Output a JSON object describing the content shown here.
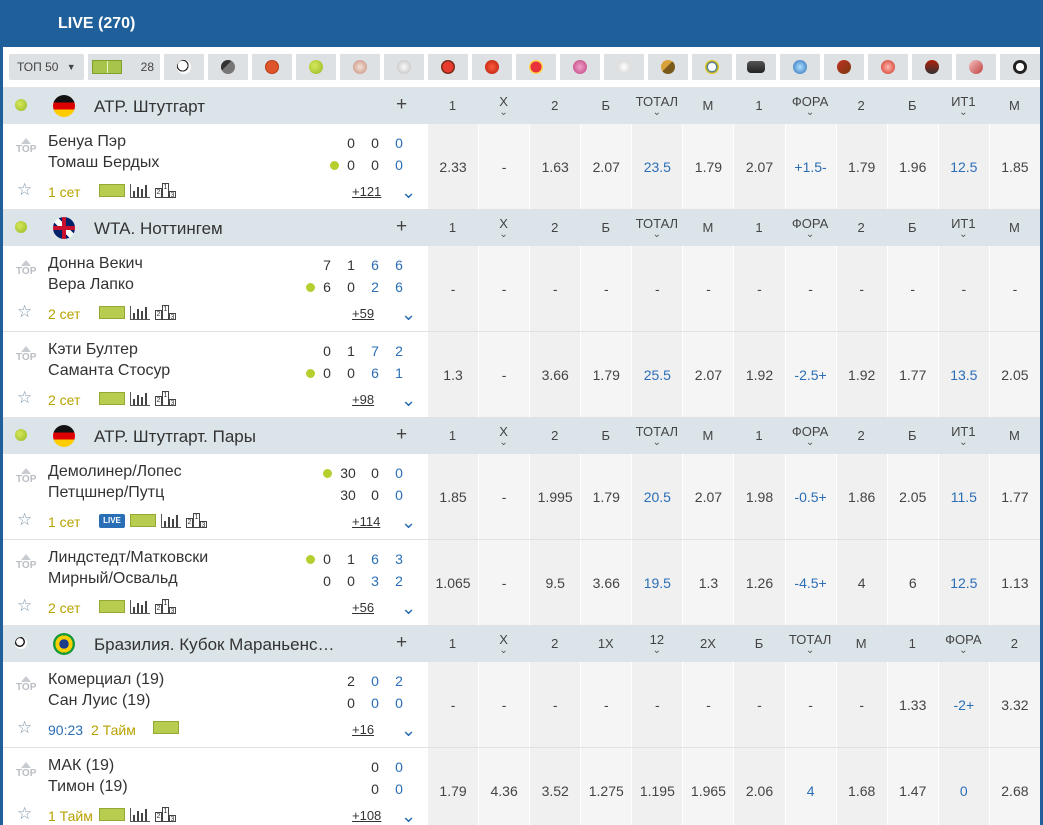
{
  "header": {
    "title": "LIVE (270)"
  },
  "filters": {
    "top_label": "ТОП 50",
    "field_count": "28",
    "sport_icons": [
      "football-icon",
      "hockey-icon",
      "basketball-icon",
      "tennis-icon",
      "volleyball-icon",
      "handball-icon",
      "table-tennis-icon",
      "billiards-icon",
      "rugby-icon",
      "futsal-icon",
      "badminton-icon",
      "field-hockey-icon",
      "beach-volleyball-icon",
      "esports-icon",
      "water-polo-icon",
      "horse-racing-icon",
      "bandy-icon",
      "formula-icon",
      "lottery-icon",
      "cyber-football-icon"
    ]
  },
  "leagues": [
    {
      "name": "ATP. Штутгарт",
      "plus": "+",
      "sport": "tennis",
      "flag": "germany",
      "headers": [
        {
          "l": "1"
        },
        {
          "l": "X",
          "c": true
        },
        {
          "l": "2"
        },
        {
          "l": "Б"
        },
        {
          "l": "ТОТАЛ",
          "c": true
        },
        {
          "l": "М"
        },
        {
          "l": "1"
        },
        {
          "l": "ФОРА",
          "c": true
        },
        {
          "l": "2"
        },
        {
          "l": "Б"
        },
        {
          "l": "ИТ1",
          "c": true
        },
        {
          "l": "М"
        }
      ],
      "events": [
        {
          "t1": "Бенуа Пэр",
          "t2": "Томаш Бердых",
          "serve": 2,
          "s1": [
            "0",
            "0",
            "0"
          ],
          "s2": [
            "0",
            "0",
            "0"
          ],
          "period": "1 сет",
          "live": false,
          "more": "+121",
          "odds": [
            "2.33",
            "-",
            "1.63",
            "2.07",
            "23.5",
            "1.79",
            "2.07",
            "+1.5-",
            "1.79",
            "1.96",
            "12.5",
            "1.85"
          ]
        }
      ]
    },
    {
      "name": "WTA. Ноттингем",
      "plus": "+",
      "sport": "tennis",
      "flag": "uk",
      "headers": [
        {
          "l": "1"
        },
        {
          "l": "X",
          "c": true
        },
        {
          "l": "2"
        },
        {
          "l": "Б"
        },
        {
          "l": "ТОТАЛ",
          "c": true
        },
        {
          "l": "М"
        },
        {
          "l": "1"
        },
        {
          "l": "ФОРА",
          "c": true
        },
        {
          "l": "2"
        },
        {
          "l": "Б"
        },
        {
          "l": "ИТ1",
          "c": true
        },
        {
          "l": "М"
        }
      ],
      "events": [
        {
          "t1": "Донна Векич",
          "t2": "Вера Лапко",
          "serve": 2,
          "s1": [
            "7",
            "1",
            "6",
            "6"
          ],
          "s2": [
            "6",
            "0",
            "2",
            "6"
          ],
          "period": "2 сет",
          "live": false,
          "more": "+59",
          "odds": [
            "-",
            "-",
            "-",
            "-",
            "-",
            "-",
            "-",
            "-",
            "-",
            "-",
            "-",
            "-"
          ]
        },
        {
          "t1": "Кэти Бултер",
          "t2": "Саманта Стосур",
          "serve": 2,
          "s1": [
            "0",
            "1",
            "7",
            "2"
          ],
          "s2": [
            "0",
            "0",
            "6",
            "1"
          ],
          "period": "2 сет",
          "live": false,
          "more": "+98",
          "odds": [
            "1.3",
            "-",
            "3.66",
            "1.79",
            "25.5",
            "2.07",
            "1.92",
            "-2.5+",
            "1.92",
            "1.77",
            "13.5",
            "2.05"
          ]
        }
      ]
    },
    {
      "name": "ATP. Штутгарт. Пары",
      "plus": "+",
      "sport": "tennis",
      "flag": "germany",
      "headers": [
        {
          "l": "1"
        },
        {
          "l": "X",
          "c": true
        },
        {
          "l": "2"
        },
        {
          "l": "Б"
        },
        {
          "l": "ТОТАЛ",
          "c": true
        },
        {
          "l": "М"
        },
        {
          "l": "1"
        },
        {
          "l": "ФОРА",
          "c": true
        },
        {
          "l": "2"
        },
        {
          "l": "Б"
        },
        {
          "l": "ИТ1",
          "c": true
        },
        {
          "l": "М"
        }
      ],
      "events": [
        {
          "t1": "Демолинер/Лопес",
          "t2": "Петцшнер/Путц",
          "serve": 1,
          "s1": [
            "30",
            "0",
            "0"
          ],
          "s2": [
            "30",
            "0",
            "0"
          ],
          "period": "1 сет",
          "live": true,
          "more": "+114",
          "odds": [
            "1.85",
            "-",
            "1.995",
            "1.79",
            "20.5",
            "2.07",
            "1.98",
            "-0.5+",
            "1.86",
            "2.05",
            "11.5",
            "1.77"
          ]
        },
        {
          "t1": "Линдстедт/Матковски",
          "t2": "Мирный/Освальд",
          "serve": 1,
          "s1": [
            "0",
            "1",
            "6",
            "3"
          ],
          "s2": [
            "0",
            "0",
            "3",
            "2"
          ],
          "period": "2 сет",
          "live": false,
          "more": "+56",
          "odds": [
            "1.065",
            "-",
            "9.5",
            "3.66",
            "19.5",
            "1.3",
            "1.26",
            "-4.5+",
            "4",
            "6",
            "12.5",
            "1.13"
          ]
        }
      ]
    },
    {
      "name": "Бразилия. Кубок Мараньенс…",
      "plus": "+",
      "sport": "football",
      "flag": "brazil",
      "headers": [
        {
          "l": "1"
        },
        {
          "l": "X",
          "c": true
        },
        {
          "l": "2"
        },
        {
          "l": "1X"
        },
        {
          "l": "12",
          "c": true
        },
        {
          "l": "2X"
        },
        {
          "l": "Б"
        },
        {
          "l": "ТОТАЛ",
          "c": true
        },
        {
          "l": "М"
        },
        {
          "l": "1"
        },
        {
          "l": "ФОРА",
          "c": true
        },
        {
          "l": "2"
        }
      ],
      "events": [
        {
          "t1": "Комерциал (19)",
          "t2": "Сан Луис (19)",
          "serve": 0,
          "s1": [
            "2",
            "0",
            "2"
          ],
          "s2": [
            "0",
            "0",
            "0"
          ],
          "period": "90:23",
          "period2": "2 Тайм",
          "live": false,
          "more": "+16",
          "odds": [
            "-",
            "-",
            "-",
            "-",
            "-",
            "-",
            "-",
            "-",
            "-",
            "1.33",
            "-2+",
            "3.32"
          ]
        },
        {
          "t1": "МАК (19)",
          "t2": "Тимон (19)",
          "serve": 0,
          "s1": [
            "0",
            "0"
          ],
          "s2": [
            "0",
            "0"
          ],
          "period": "1 Тайм",
          "live": false,
          "more": "+108",
          "odds": [
            "1.79",
            "4.36",
            "3.52",
            "1.275",
            "1.195",
            "1.965",
            "2.06",
            "4",
            "1.68",
            "1.47",
            "0",
            "2.68"
          ]
        }
      ]
    }
  ],
  "colors": {
    "header_bg": "#1f5f9a",
    "league_bg": "#dbe4e8",
    "accent_blue": "#2a6eb6",
    "period_yellow": "#b8a200"
  }
}
